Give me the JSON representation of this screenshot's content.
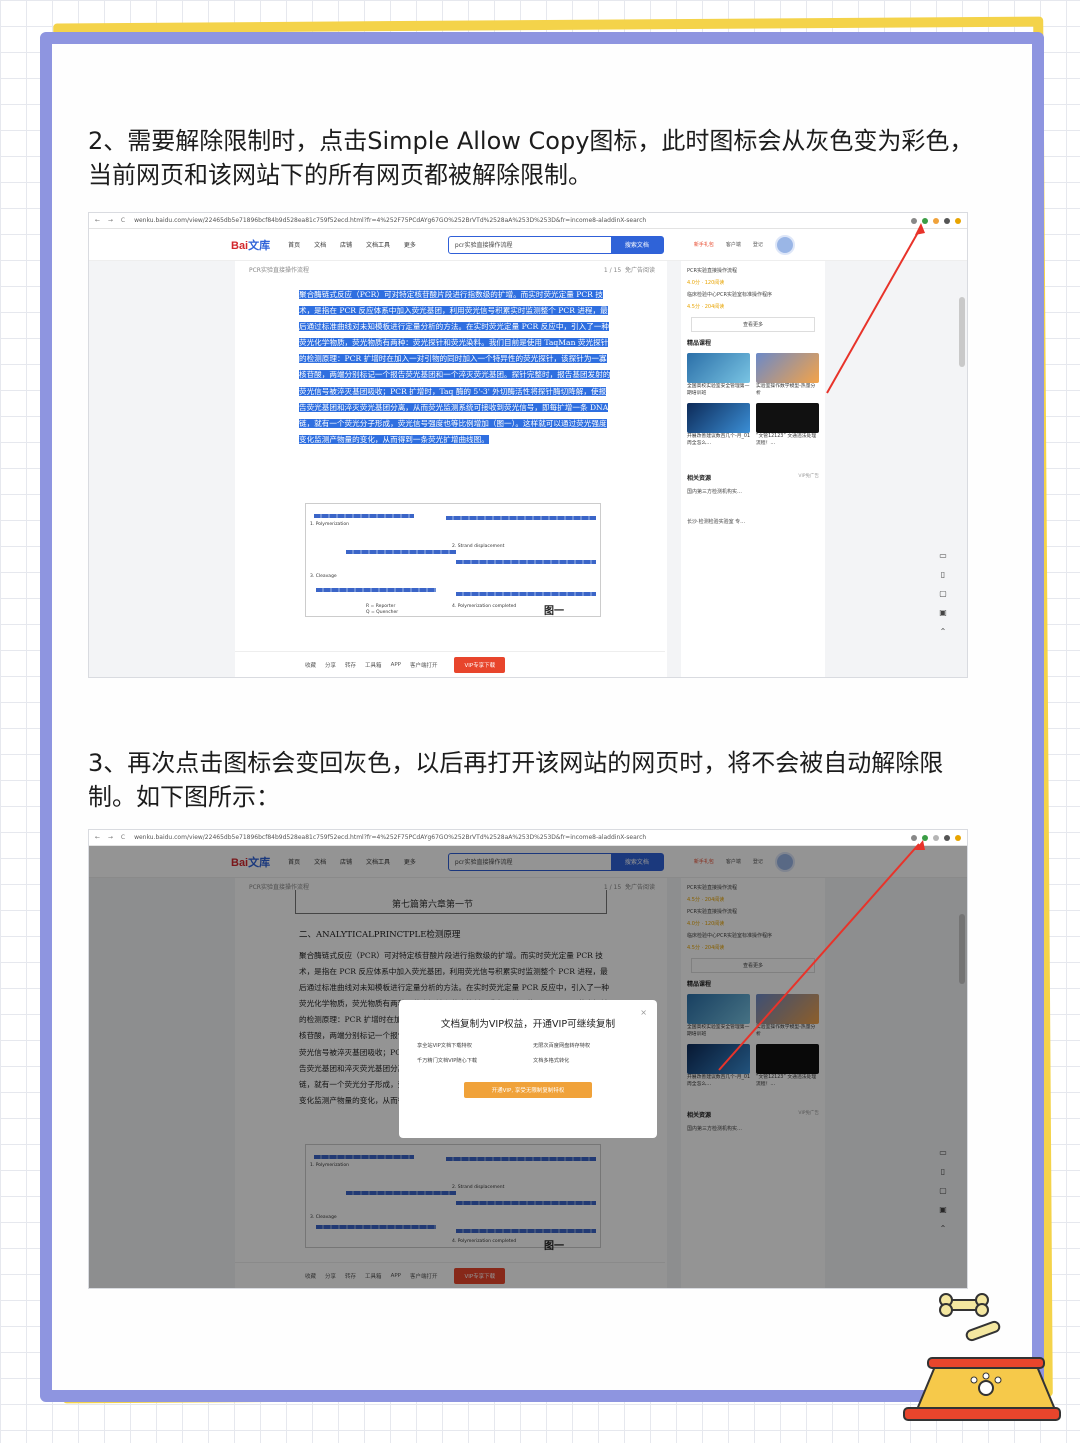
{
  "captions": {
    "step2": "2、需要解除限制时，点击Simple Allow Copy图标，此时图标会从灰色变为彩色，当前网页和该网站下的所有网页都被解除限制。",
    "step3": "3、再次点击图标会变回灰色，以后再打开该网站的网页时，将不会被自动解除限制。如下图所示："
  },
  "browser": {
    "url": "wenku.baidu.com/view/22465db5e71896bcf84b9d528ea81c759f52ecd.html?fr=4%252F75PCdAYg67GO%252BrVTd%2528aA%253D%253D&fr=income8-aladdinX-search",
    "nav_buttons": "← → C"
  },
  "site": {
    "logo_main": "Bai",
    "logo_sub": "文库",
    "nav": [
      "首页",
      "文档",
      "店铺",
      "文档工具",
      "更多"
    ],
    "search_query": "pcr实验直接操作流程",
    "search_button": "搜索文档",
    "top_icons": [
      "新手礼包",
      "客户端",
      "登记"
    ],
    "doc_title": "PCR实验直接操作流程",
    "page_indicator": "1 / 15",
    "ad_label": "免广告阅读"
  },
  "doc": {
    "paragraph": "聚合酶链式反应（PCR）可对特定核苷酸片段进行指数级的扩增。而实时荧光定量 PCR 技术，是指在 PCR 反应体系中加入荧光基团，利用荧光信号积累实时监测整个 PCR 进程，最后通过标准曲线对未知模板进行定量分析的方法。在实时荧光定量 PCR 反应中，引入了一种荧光化学物质，荧光物质有两种：荧光探针和荧光染料。我们目前是使用 TaqMan 荧光探针的检测原理：PCR 扩增时在加入一对引物的同时加入一个特异性的荧光探针，该探针为一寡核苷酸，两端分别标记一个报告荧光基团和一个淬灭荧光基团。探针完整时，报告基团发射的荧光信号被淬灭基团吸收；PCR 扩增时，Taq 酶的 5'-3' 外切酶活性将探针酶切降解，使报告荧光基团和淬灭荧光基团分离，从而荧光监测系统可接收到荧光信号，即每扩增一条 DNA 链，就有一个荧光分子形成，荧光信号强度也等比例增加（图一）。这样就可以通过荧光强度变化监测产物量的变化，从而得到一条荧光扩增曲线图。",
    "paragraph_end": "变化监测产物量的变化，从而得到一条荧光扩增曲线图。",
    "figure_labels": [
      "1. Polymerization",
      "2. Strand displacement",
      "3. Cleavage",
      "4. Polymerization completed",
      "R = Reporter",
      "Q = Quencher"
    ],
    "figure_tag": "图一",
    "chapter": "第七篇第六章第一节",
    "heading": "二、ANALYTICALPRINCTPLE检测原理"
  },
  "toolbar": {
    "items": [
      "收藏",
      "分享",
      "转存",
      "工具箱",
      "APP",
      "客户端打开"
    ],
    "download": "VIP专享下载"
  },
  "sidebar": {
    "related_docs": [
      "PCR实验直接操作流程",
      "临床检验中心PCR实验室标准操作程序"
    ],
    "ratings": [
      "4.0分 · 120阅读",
      "4.5分 · 204阅读"
    ],
    "see_more": "查看更多",
    "courses_title": "精品课程",
    "courses": [
      "全国高校实验室安全管理第一期培训班",
      "实验室操作数学模型-热量分析",
      "开展改善建议数百几个-月_01周全怎么…",
      "“文管12123” 文通违法处理流程！…"
    ],
    "resources_title": "相关资源",
    "resource_tag": "VIP免广告",
    "resources": [
      "国内第三方检测机构实…",
      "长沙·检测检验实验室 专…"
    ]
  },
  "dialog": {
    "title": "文档复制为VIP权益，开通VIP可继续复制",
    "features": [
      "享全站VIP文档下载特权",
      "无限次百度网盘转存特权",
      "千万精门文档VIP随心下载",
      "文档多格式转化"
    ],
    "cta": "开通VIP, 享受无限制复制特权"
  },
  "colors": {
    "frame": "#8e95e0",
    "frame_shadow": "#f4d34a",
    "selection": "#2f6fe0",
    "brand_blue": "#2f63d8",
    "download_red": "#e8452c",
    "arrow": "#e8332a"
  }
}
